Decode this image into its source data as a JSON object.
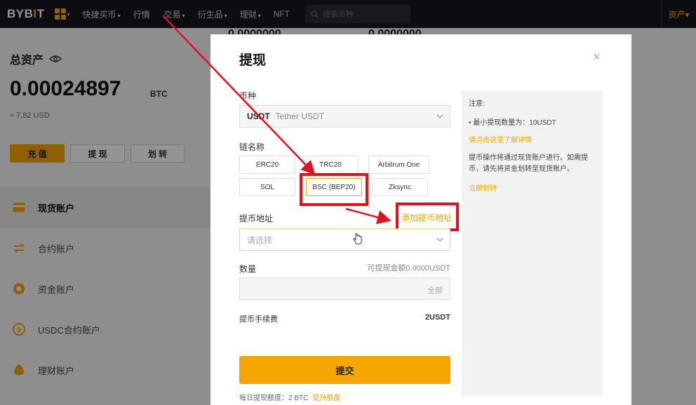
{
  "nav": {
    "logo_prefix": "BYB",
    "logo_dot": "I",
    "logo_suffix": "T",
    "items": [
      {
        "label": "快捷买币",
        "caret": "▾"
      },
      {
        "label": "行情",
        "caret": ""
      },
      {
        "label": "交易",
        "caret": "▾"
      },
      {
        "label": "衍生品",
        "caret": "▾"
      },
      {
        "label": "理财",
        "caret": "▾"
      },
      {
        "label": "NFT",
        "caret": ""
      }
    ],
    "search_placeholder": "搜索币种",
    "assets_label": "资产▾"
  },
  "left": {
    "total_assets_label": "总资产",
    "balance": "0.00024897",
    "balance_unit": "BTC",
    "usd_value": "≈ 7.82 USD",
    "buttons": {
      "deposit": "充 值",
      "withdraw": "提 现",
      "transfer": "划 转"
    },
    "accounts": [
      {
        "label": "现货账户",
        "icon": "wallet-icon"
      },
      {
        "label": "合约账户",
        "icon": "swap-icon"
      },
      {
        "label": "资金账户",
        "icon": "coin-icon"
      },
      {
        "label": "USDC合约账户",
        "icon": "dollar-icon"
      },
      {
        "label": "理财账户",
        "icon": "bag-icon"
      }
    ],
    "bg_values": [
      "0.0000000",
      "0.0000000"
    ]
  },
  "modal": {
    "title": "提现",
    "close": "×",
    "coin_label": "币种",
    "coin_symbol": "USDT",
    "coin_name": "Tether USDT",
    "chain_label": "链名称",
    "chains": [
      "ERC20",
      "TRC20",
      "Arbitrum One",
      "SOL",
      "BSC (BEP20)",
      "Zksync"
    ],
    "selected_chain": "BSC (BEP20)",
    "address_label": "提币地址",
    "add_address": "添加提币地址",
    "address_placeholder": "请选择",
    "amount_label": "数量",
    "available": "可提现金额0.0000USDT",
    "all_label": "全部",
    "fee_label": "提币手续费",
    "fee_value": "2USDT",
    "submit_label": "提交",
    "daily_limit": "每日提现额度：2 BTC",
    "raise_limit": "提升额度"
  },
  "notes": {
    "heading": "注意:",
    "min_withdraw": "• 最小提现数量为：10USDT",
    "details_link": "请点击这里了解详情",
    "text": "提币操作将通过现货账户进行。如需提币，请先将资金划转至现货账户。",
    "transfer_link": "立即划转"
  },
  "colors": {
    "accent": "#f7a600",
    "highlight": "#e5101e",
    "nav_bg": "#17181e"
  }
}
